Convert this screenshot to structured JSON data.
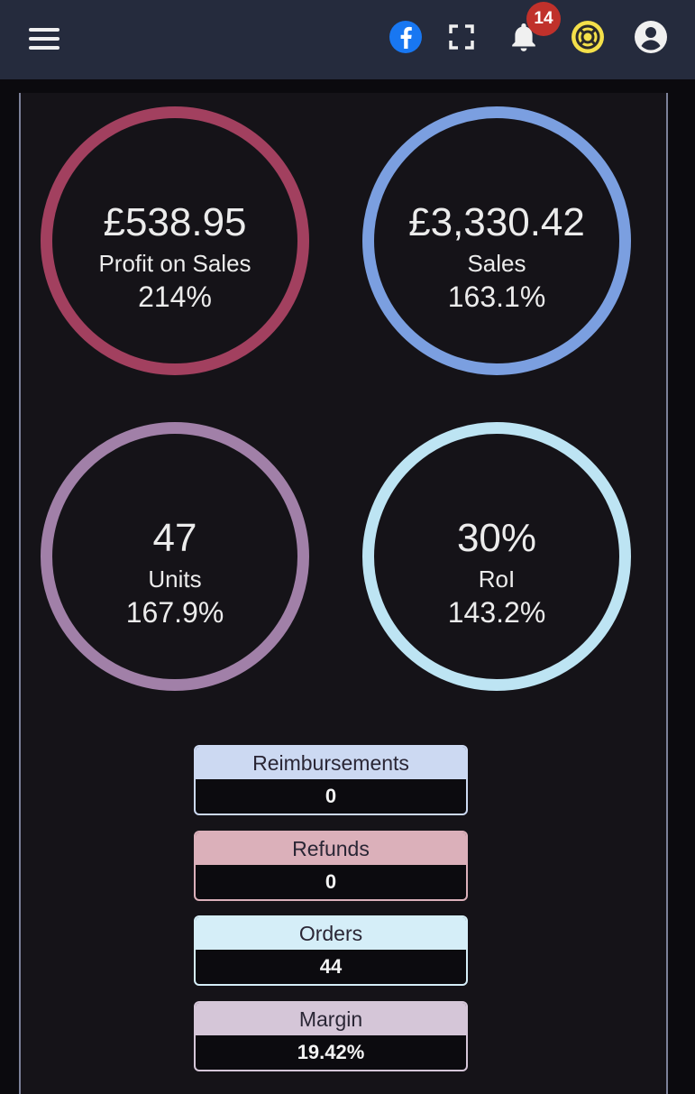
{
  "header": {
    "notification_count": "14",
    "icons": [
      "menu-icon",
      "facebook-icon",
      "fullscreen-icon",
      "bell-icon",
      "help-lifebuoy-icon",
      "user-account-icon"
    ]
  },
  "metrics": [
    {
      "value": "£538.95",
      "label": "Profit on Sales",
      "percent": "214%",
      "color": "#a2405f"
    },
    {
      "value": "£3,330.42",
      "label": "Sales",
      "percent": "163.1%",
      "color": "#7b9fe0"
    },
    {
      "value": "47",
      "label": "Units",
      "percent": "167.9%",
      "color": "#a180a8"
    },
    {
      "value": "30%",
      "label": "RoI",
      "percent": "143.2%",
      "color": "#bde4f3"
    }
  ],
  "stats": [
    {
      "label": "Reimbursements",
      "value": "0",
      "color": "#ccd9f2"
    },
    {
      "label": "Refunds",
      "value": "0",
      "color": "#dbb0ba"
    },
    {
      "label": "Orders",
      "value": "44",
      "color": "#d5eef8"
    },
    {
      "label": "Margin",
      "value": "19.42%",
      "color": "#d5c6d8"
    }
  ]
}
